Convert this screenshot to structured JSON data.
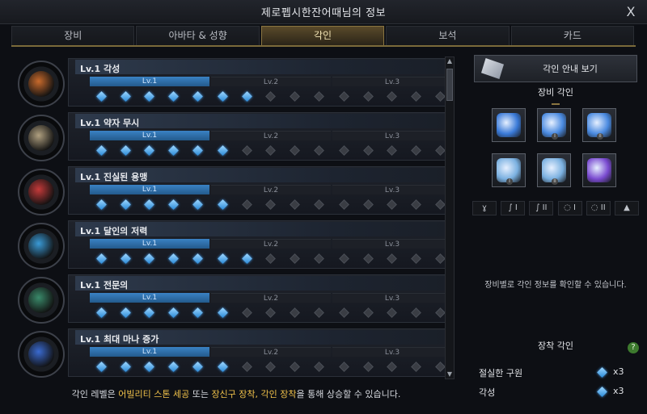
{
  "window": {
    "title": "제로펩시한잔어때님의 정보",
    "close": "X"
  },
  "tabs": [
    {
      "label": "장비",
      "active": false
    },
    {
      "label": "아바타 & 성향",
      "active": false
    },
    {
      "label": "각인",
      "active": true
    },
    {
      "label": "보석",
      "active": false
    },
    {
      "label": "카드",
      "active": false
    }
  ],
  "engravings": [
    {
      "name": "Lv.1 각성",
      "levels": [
        "Lv.1",
        "Lv.2",
        "Lv.3"
      ],
      "lit_nodes": 7,
      "icon": "awakening-icon",
      "color": "#c86a2c"
    },
    {
      "name": "Lv.1 약자 무시",
      "levels": [
        "Lv.1",
        "Lv.2",
        "Lv.3"
      ],
      "lit_nodes": 6,
      "icon": "ignore-weak-icon",
      "color": "#b0a080"
    },
    {
      "name": "Lv.1 진실된 용맹",
      "levels": [
        "Lv.1",
        "Lv.2",
        "Lv.3"
      ],
      "lit_nodes": 6,
      "icon": "true-courage-icon",
      "color": "#c43a3a"
    },
    {
      "name": "Lv.1 달인의 저력",
      "levels": [
        "Lv.1",
        "Lv.2",
        "Lv.3"
      ],
      "lit_nodes": 7,
      "icon": "master-strength-icon",
      "color": "#3a9ad6"
    },
    {
      "name": "Lv.1 전문의",
      "levels": [
        "Lv.1",
        "Lv.2",
        "Lv.3"
      ],
      "lit_nodes": 6,
      "icon": "specialist-icon",
      "color": "#3a8a6a"
    },
    {
      "name": "Lv.1 최대 마나 증가",
      "levels": [
        "Lv.1",
        "Lv.2",
        "Lv.3"
      ],
      "lit_nodes": 6,
      "icon": "max-mana-icon",
      "color": "#3a6ad0"
    }
  ],
  "bottom_note": {
    "prefix": "각인 레벨은 ",
    "hl1": "어빌리티 스톤 세공",
    "mid1": " 또는 ",
    "hl2": "장신구 장착, 각인 장착",
    "suffix": "을 통해 상승할 수 있습니다."
  },
  "right_panel": {
    "guide_button": "각인 안내 보기",
    "equip_engraving_title": "장비 각인",
    "equip_info_text": "장비별로 각인 정보를 확인할 수 있습니다.",
    "mounted_title": "장착 각인",
    "help": "?",
    "mounted": [
      {
        "name": "절실한 구원",
        "count": "x3"
      },
      {
        "name": "각성",
        "count": "x3"
      }
    ],
    "slots": [
      {
        "name": "necklace-slot",
        "tier": "",
        "color": "#3a7ad8"
      },
      {
        "name": "earring-1-slot",
        "tier": "I",
        "color": "#4a8ae0"
      },
      {
        "name": "earring-2-slot",
        "tier": "II",
        "color": "#4a8ae0"
      },
      {
        "name": "ring-1-slot",
        "tier": "I",
        "color": "#7ab0e0"
      },
      {
        "name": "ring-2-slot",
        "tier": "II",
        "color": "#7ab0e0"
      },
      {
        "name": "ability-stone-slot",
        "tier": "",
        "color": "#7a4ad0"
      }
    ],
    "filter_icons": [
      {
        "icon": "necklace-filter-icon",
        "glyph": "ɣ"
      },
      {
        "icon": "earring-1-filter-icon",
        "glyph": "∫ I"
      },
      {
        "icon": "earring-2-filter-icon",
        "glyph": "∫ II"
      },
      {
        "icon": "ring-1-filter-icon",
        "glyph": "◌ I"
      },
      {
        "icon": "ring-2-filter-icon",
        "glyph": "◌ II"
      },
      {
        "icon": "stone-filter-icon",
        "glyph": "▲"
      }
    ]
  }
}
